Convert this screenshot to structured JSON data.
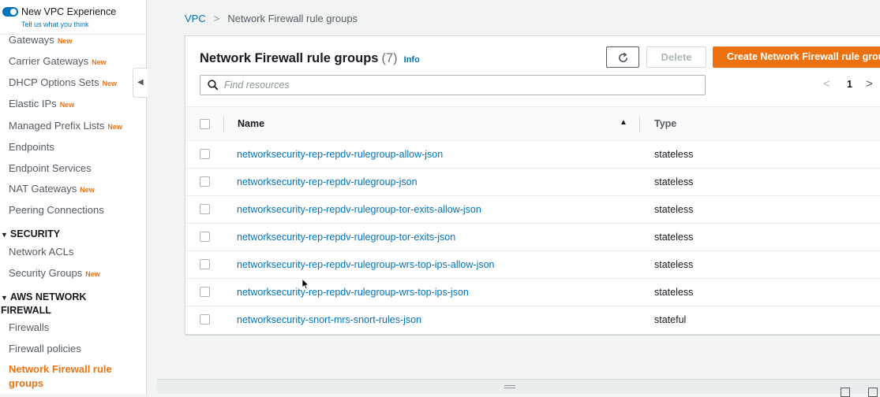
{
  "vpc_experience": {
    "title": "New VPC Experience",
    "subtitle": "Tell us what you think",
    "toggle_on": true
  },
  "sidebar": {
    "new_badge": "New",
    "items": [
      {
        "label": "Gateways",
        "new": true
      },
      {
        "label": "Carrier Gateways",
        "new": true
      },
      {
        "label": "DHCP Options Sets",
        "new": true
      },
      {
        "label": "Elastic IPs",
        "new": true
      },
      {
        "label": "Managed Prefix Lists",
        "new": true
      },
      {
        "label": "Endpoints",
        "new": false
      },
      {
        "label": "Endpoint Services",
        "new": false
      },
      {
        "label": "NAT Gateways",
        "new": true
      },
      {
        "label": "Peering Connections",
        "new": false
      }
    ],
    "security_section": "SECURITY",
    "security_items": [
      {
        "label": "Network ACLs",
        "new": false
      },
      {
        "label": "Security Groups",
        "new": true
      }
    ],
    "firewall_section": "AWS NETWORK FIREWALL",
    "firewall_items": [
      {
        "label": "Firewalls"
      },
      {
        "label": "Firewall policies"
      },
      {
        "label": "Network Firewall rule groups",
        "active": true
      }
    ],
    "accent_color": "#ec7211"
  },
  "breadcrumb": {
    "root": "VPC",
    "current": "Network Firewall rule groups"
  },
  "panel": {
    "title": "Network Firewall rule groups",
    "count": "(7)",
    "info_label": "Info",
    "refresh_icon": "refresh-icon",
    "delete_label": "Delete",
    "create_label": "Create Network Firewall rule group",
    "search_placeholder": "Find resources",
    "page_number": "1"
  },
  "table": {
    "columns": [
      "Name",
      "Type"
    ],
    "sort": "ascending",
    "rows": [
      {
        "name": "networksecurity-rep-repdv-rulegroup-allow-json",
        "type": "stateless"
      },
      {
        "name": "networksecurity-rep-repdv-rulegroup-json",
        "type": "stateless"
      },
      {
        "name": "networksecurity-rep-repdv-rulegroup-tor-exits-allow-json",
        "type": "stateless"
      },
      {
        "name": "networksecurity-rep-repdv-rulegroup-tor-exits-json",
        "type": "stateless"
      },
      {
        "name": "networksecurity-rep-repdv-rulegroup-wrs-top-ips-allow-json",
        "type": "stateless"
      },
      {
        "name": "networksecurity-rep-repdv-rulegroup-wrs-top-ips-json",
        "type": "stateless"
      },
      {
        "name": "networksecurity-snort-mrs-snort-rules-json",
        "type": "stateful"
      }
    ]
  },
  "colors": {
    "link": "#0073bb",
    "primary_button": "#ec7211"
  }
}
